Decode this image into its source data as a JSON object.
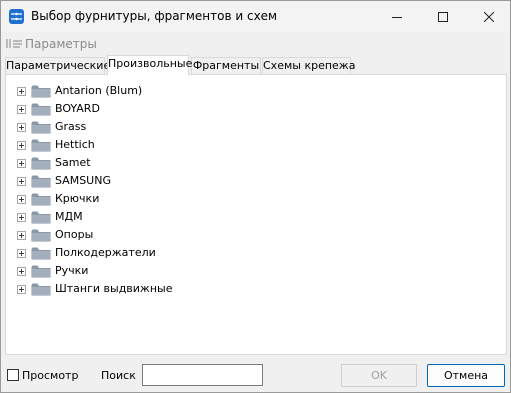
{
  "window": {
    "title": "Выбор фурнитуры, фрагментов и схем",
    "minimize_icon": "minimize-icon",
    "maximize_icon": "maximize-icon",
    "close_icon": "close-icon"
  },
  "toolbar": {
    "params_label": "Параметры",
    "params_icon": "parameters-icon"
  },
  "tabs": [
    {
      "label": "Параметрические",
      "active": false
    },
    {
      "label": "Произвольные",
      "active": true
    },
    {
      "label": "Фрагменты",
      "active": false
    },
    {
      "label": "Схемы крепежа",
      "active": false
    }
  ],
  "tree": {
    "items": [
      {
        "label": "Antarion (Blum)"
      },
      {
        "label": "BOYARD"
      },
      {
        "label": "Grass"
      },
      {
        "label": "Hettich"
      },
      {
        "label": "Samet"
      },
      {
        "label": "SAMSUNG"
      },
      {
        "label": "Крючки"
      },
      {
        "label": "МДМ"
      },
      {
        "label": "Опоры"
      },
      {
        "label": "Полкодержатели"
      },
      {
        "label": "Ручки"
      },
      {
        "label": "Штанги выдвижные"
      }
    ]
  },
  "bottom": {
    "preview_label": "Просмотр",
    "preview_checked": false,
    "search_label": "Поиск",
    "search_value": "",
    "ok_label": "OK",
    "cancel_label": "Отмена"
  },
  "colors": {
    "accent": "#0067c0",
    "folder": "#8c9aa8"
  }
}
